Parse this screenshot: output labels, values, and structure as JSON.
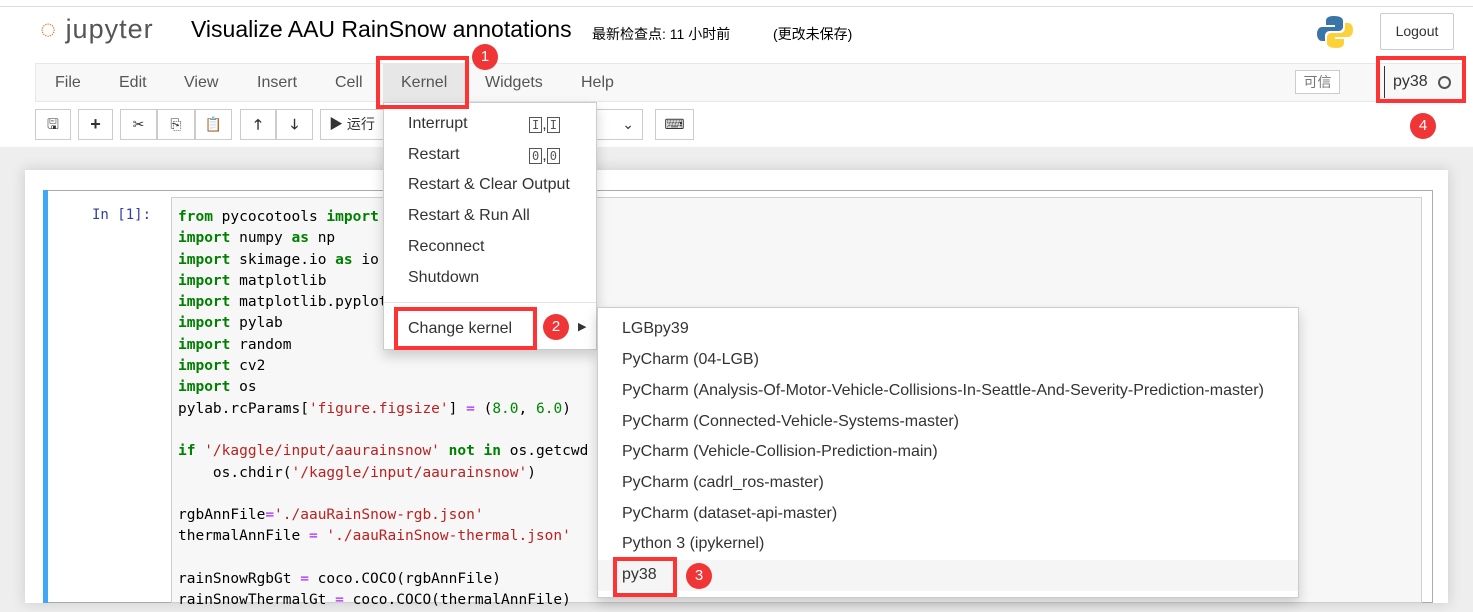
{
  "header": {
    "logo": "jupyter",
    "title": "Visualize AAU RainSnow annotations",
    "checkpoint": "最新检查点: 11 小时前",
    "unsaved": "(更改未保存)",
    "logout": "Logout"
  },
  "menubar": {
    "items": [
      "File",
      "Edit",
      "View",
      "Insert",
      "Cell",
      "Kernel",
      "Widgets",
      "Help"
    ],
    "trusted": "可信",
    "kernel_name": "py38"
  },
  "toolbar": {
    "run": "运行"
  },
  "cell": {
    "prompt": "In  [1]:"
  },
  "kernel_menu": {
    "items": [
      {
        "label": "Interrupt",
        "keys": [
          "I",
          "I"
        ]
      },
      {
        "label": "Restart",
        "keys": [
          "0",
          "0"
        ]
      },
      {
        "label": "Restart & Clear Output"
      },
      {
        "label": "Restart & Run All"
      },
      {
        "label": "Reconnect"
      },
      {
        "label": "Shutdown"
      }
    ],
    "change_kernel": "Change kernel"
  },
  "kernels": [
    "LGBpy39",
    "PyCharm (04-LGB)",
    "PyCharm (Analysis-Of-Motor-Vehicle-Collisions-In-Seattle-And-Severity-Prediction-master)",
    "PyCharm (Connected-Vehicle-Systems-master)",
    "PyCharm (Vehicle-Collision-Prediction-main)",
    "PyCharm (cadrl_ros-master)",
    "PyCharm (dataset-api-master)",
    "Python 3 (ipykernel)",
    "py38"
  ],
  "badges": [
    "1",
    "2",
    "3",
    "4"
  ],
  "colors": {
    "annotation": "#ff3333",
    "cell_border": "#42a5f5"
  }
}
